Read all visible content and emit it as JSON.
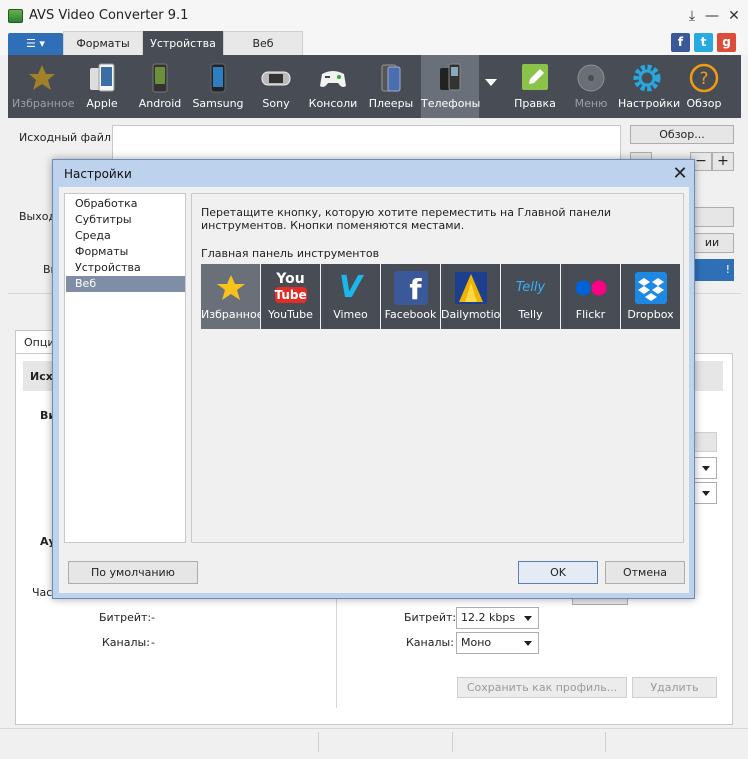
{
  "window": {
    "title": "AVS Video Converter 9.1"
  },
  "tabs": [
    {
      "label": "Форматы",
      "active": false
    },
    {
      "label": "Устройства",
      "active": true
    },
    {
      "label": "Веб",
      "active": false
    }
  ],
  "toolbar": {
    "items": [
      {
        "label": "Избранное",
        "icon": "star-icon"
      },
      {
        "label": "Apple",
        "icon": "apple-device-icon"
      },
      {
        "label": "Android",
        "icon": "android-phone-icon"
      },
      {
        "label": "Samsung",
        "icon": "samsung-phone-icon"
      },
      {
        "label": "Sony",
        "icon": "psp-icon"
      },
      {
        "label": "Консоли",
        "icon": "gamepad-icon"
      },
      {
        "label": "Плееры",
        "icon": "player-icon"
      },
      {
        "label": "Телефоны",
        "icon": "feature-phone-icon"
      },
      {
        "label": "Правка",
        "icon": "edit-icon"
      },
      {
        "label": "Меню",
        "icon": "disc-menu-icon"
      },
      {
        "label": "Настройки",
        "icon": "gear-icon"
      },
      {
        "label": "Обзор",
        "icon": "help-icon"
      }
    ]
  },
  "main": {
    "source_label": "Исходный файл:",
    "browse_label": "Обзор...",
    "output_label_partial": "Выход",
    "partial_label_v": "Ви",
    "options_tab_partial": "Опци",
    "source_section_partial": "Исх",
    "video_partial": "Ви",
    "audio_partial": "Ау",
    "freq_partial": "Част",
    "right_btn_partial_1": "ии",
    "right_btn_partial_2": "!",
    "left_bitrate_label": "Битрейт:",
    "left_bitrate_value": "-",
    "left_channels_label": "Каналы:",
    "left_channels_value": "-",
    "right_bitrate_label": "Битрейт:",
    "right_bitrate_value": "12.2 kbps",
    "right_channels_label": "Каналы:",
    "right_channels_value": "Моно",
    "save_profile_label": "Сохранить как профиль...",
    "delete_label": "Удалить"
  },
  "dialog": {
    "title": "Настройки",
    "nav": [
      "Обработка",
      "Субтитры",
      "Среда",
      "Форматы",
      "Устройства",
      "Веб"
    ],
    "selected_nav": "Веб",
    "description": "Перетащите кнопку, которую хотите переместить на Главной панели инструментов. Кнопки поменяются местами.",
    "section_label": "Главная панель инструментов",
    "buttons": [
      {
        "label": "Избранное",
        "icon": "star-icon"
      },
      {
        "label": "YouTube",
        "icon": "youtube-icon",
        "icon_top": "You",
        "icon_bottom": "Tube"
      },
      {
        "label": "Vimeo",
        "icon": "vimeo-icon",
        "glyph": "V"
      },
      {
        "label": "Facebook",
        "icon": "facebook-icon",
        "glyph": "f"
      },
      {
        "label": "Dailymotion",
        "icon": "dailymotion-icon"
      },
      {
        "label": "Telly",
        "icon": "telly-icon",
        "glyph": "Telly"
      },
      {
        "label": "Flickr",
        "icon": "flickr-icon"
      },
      {
        "label": "Dropbox",
        "icon": "dropbox-icon"
      }
    ],
    "default_button": "По умолчанию",
    "ok_button": "OK",
    "cancel_button": "Отмена"
  },
  "colors": {
    "accent": "#2f6fb8",
    "toolbar": "#474c55",
    "selected": "#6a707a",
    "edit_green": "#8bc34a",
    "gear_blue": "#29a8e0",
    "help_orange": "#f39c12"
  }
}
